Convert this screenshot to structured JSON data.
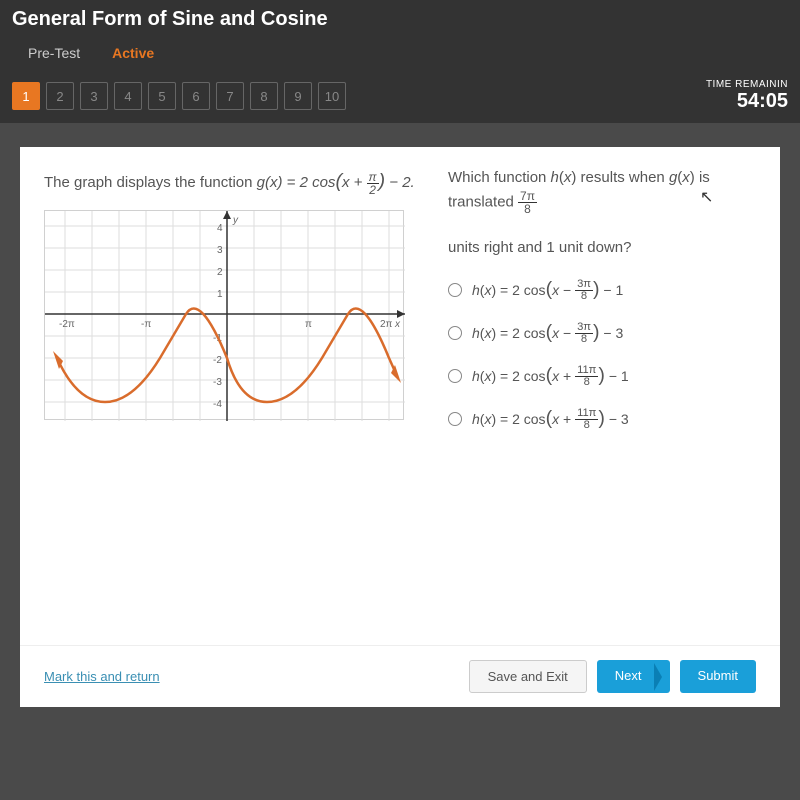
{
  "header": {
    "title": "General Form of Sine and Cosine",
    "tabs": [
      "Pre-Test",
      "Active"
    ],
    "activeTab": 1
  },
  "nav": {
    "questions": [
      "1",
      "2",
      "3",
      "4",
      "5",
      "6",
      "7",
      "8",
      "9",
      "10"
    ],
    "current": 0,
    "timerLabel": "TIME REMAININ",
    "timerValue": "54:05"
  },
  "question": {
    "leftPrefix": "The graph displays the function ",
    "leftMath": "g(x) = 2 cos(x + π/2) − 2.",
    "rightPrefix": "Which function ",
    "rightMid": " results when ",
    "rightSuffix": " is translated ",
    "rightFracN": "7π",
    "rightFracD": "8",
    "rightLine2": "units right and 1 unit down?"
  },
  "options": {
    "a": "h(x) = 2 cos(x − 3π/8) − 1",
    "b": "h(x) = 2 cos(x − 3π/8) − 3",
    "c": "h(x) = 2 cos(x + 11π/8) − 1",
    "d": "h(x) = 2 cos(x + 11π/8) − 3"
  },
  "footer": {
    "mark": "Mark this and return",
    "save": "Save and Exit",
    "next": "Next",
    "submit": "Submit"
  },
  "chart_data": {
    "type": "line",
    "title": "",
    "xlabel": "x",
    "ylabel": "y",
    "xlim": [
      -6.283,
      6.283
    ],
    "ylim": [
      -4,
      4
    ],
    "xticks": [
      {
        "v": -6.283,
        "l": "-2π"
      },
      {
        "v": -3.1416,
        "l": "-π"
      },
      {
        "v": 3.1416,
        "l": "π"
      },
      {
        "v": 6.283,
        "l": "2π"
      }
    ],
    "yticks": [
      -4,
      -3,
      -2,
      -1,
      1,
      2,
      3,
      4
    ],
    "function": "2*cos(x + pi/2) - 2",
    "amplitude": 2,
    "phase_shift": -1.5708,
    "vertical_shift": -2,
    "sample_points": [
      {
        "x": -6.283,
        "y": -2
      },
      {
        "x": -4.712,
        "y": -4
      },
      {
        "x": -3.1416,
        "y": -2
      },
      {
        "x": -1.5708,
        "y": 0
      },
      {
        "x": 0,
        "y": -2
      },
      {
        "x": 1.5708,
        "y": -4
      },
      {
        "x": 3.1416,
        "y": -2
      },
      {
        "x": 4.712,
        "y": 0
      },
      {
        "x": 6.283,
        "y": -2
      }
    ]
  }
}
